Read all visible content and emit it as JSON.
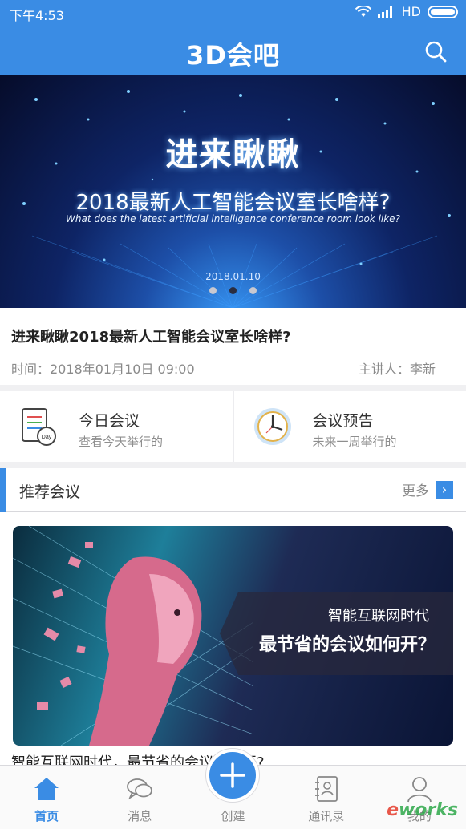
{
  "status_bar": {
    "time": "下午4:53",
    "network": "HD"
  },
  "header": {
    "title": "3D会吧"
  },
  "banner": {
    "title": "进来瞅瞅",
    "subtitle": "2018最新人工智能会议室长啥样?",
    "subtitle_en": "What does the latest artificial intelligence conference room look like?",
    "date": "2018.01.10",
    "pages": 3,
    "active_page": 2
  },
  "article": {
    "title": "进来瞅瞅2018最新人工智能会议室长啥样?",
    "time": "时间：2018年01月10日 09:00",
    "host": "主讲人：李新"
  },
  "quick": [
    {
      "title": "今日会议",
      "subtitle": "查看今天举行的",
      "icon": "calendar-day-icon"
    },
    {
      "title": "会议预告",
      "subtitle": "未来一周举行的",
      "icon": "clock-icon"
    }
  ],
  "section": {
    "title": "推荐会议",
    "more": "更多"
  },
  "recommend": {
    "image_line1": "智能互联网时代",
    "image_line2": "最节省的会议如何开？",
    "caption": "智能互联网时代，最节省的会议如何开?"
  },
  "tabbar": {
    "items": [
      {
        "label": "首页",
        "icon": "home-icon",
        "active": true
      },
      {
        "label": "消息",
        "icon": "chat-icon",
        "active": false
      },
      {
        "label": "创建",
        "icon": "plus-icon",
        "active": false
      },
      {
        "label": "通讯录",
        "icon": "contacts-icon",
        "active": false
      },
      {
        "label": "我的",
        "icon": "user-icon",
        "active": false
      }
    ]
  },
  "watermark": {
    "prefix": "e",
    "text": "works"
  },
  "colors": {
    "accent": "#3a8ce4",
    "background": "#f0f0f2"
  }
}
